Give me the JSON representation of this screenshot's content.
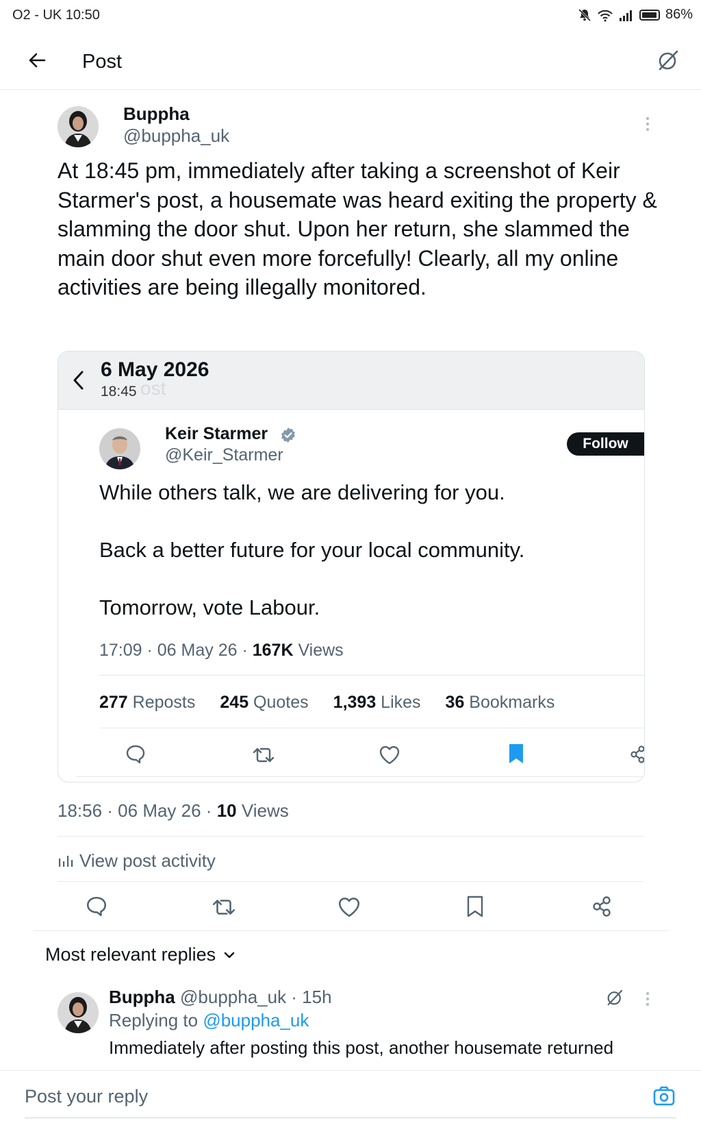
{
  "status_bar": {
    "carrier_time": "O2 - UK 10:50",
    "battery": "86%"
  },
  "header": {
    "title": "Post"
  },
  "post": {
    "name": "Buppha",
    "handle": "@buppha_uk",
    "text": "At 18:45 pm, immediately after taking a screenshot of Keir Starmer's post, a housemate was heard exiting the property & slamming the door shut. Upon her return, she slammed the main door shut even more forcefully! Clearly, all my online activities are being illegally monitored.",
    "time": "18:56 · 06 May 26 · ",
    "views_count": "10",
    "views_label": " Views",
    "activity": "View post activity"
  },
  "embed": {
    "date": "6 May 2026",
    "time": "18:45",
    "ghost": "ost",
    "name": "Keir Starmer",
    "handle": "@Keir_Starmer",
    "follow": "Follow",
    "line1": "While others talk, we are delivering for you.",
    "line2": "Back a better future for your local community.",
    "line3": "Tomorrow, vote Labour.",
    "meta_time": "17:09 · 06 May 26 · ",
    "views_count": "167K",
    "views_label": " Views",
    "reposts_count": "277",
    "reposts_label": " Reposts",
    "quotes_count": "245",
    "quotes_label": " Quotes",
    "likes_count": "1,393",
    "likes_label": " Likes",
    "bookmarks_count": "36",
    "bookmarks_label": " Bookmarks"
  },
  "replies": {
    "heading": "Most relevant replies",
    "items": [
      {
        "name": "Buppha",
        "handle": "@buppha_uk",
        "age": " · 15h",
        "replying_to_label": "Replying to ",
        "replying_to_handle": "@buppha_uk",
        "text": "Immediately after posting this post, another housemate returned"
      }
    ]
  },
  "composer": {
    "placeholder": "Post your reply"
  },
  "colors": {
    "accent": "#1d9bf0",
    "muted": "#536471",
    "text": "#0f1419"
  }
}
